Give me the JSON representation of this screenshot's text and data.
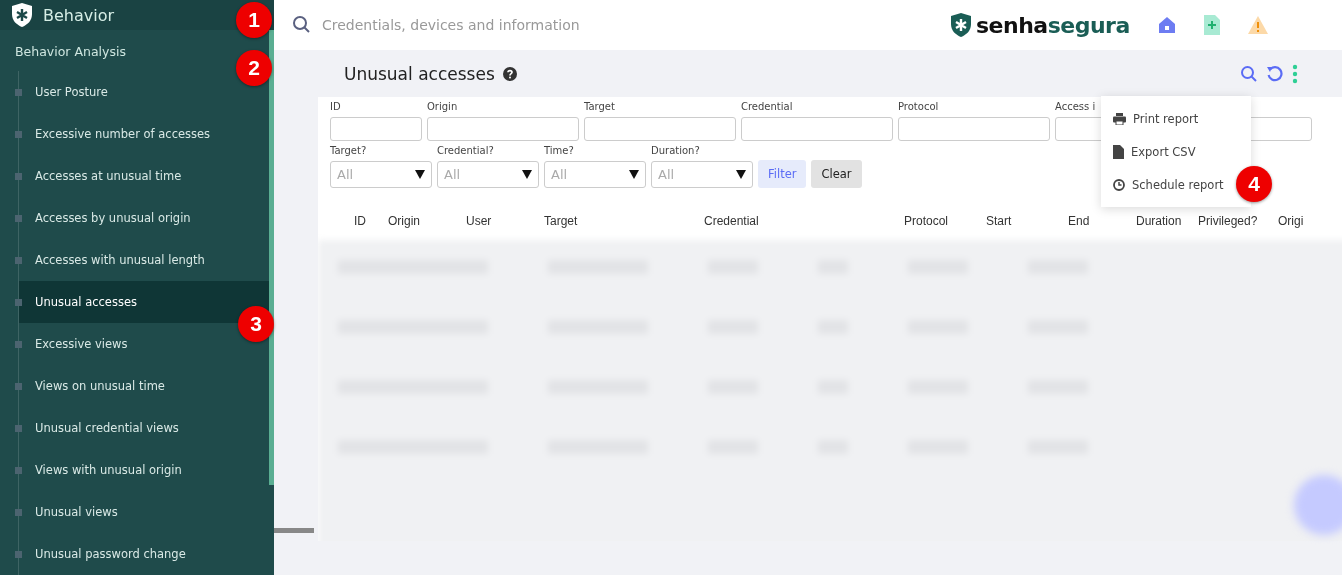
{
  "sidebar": {
    "title": "Behavior",
    "section": "Behavior Analysis",
    "items": [
      {
        "label": "User Posture",
        "selected": false
      },
      {
        "label": "Excessive number of accesses",
        "selected": false
      },
      {
        "label": "Accesses at unusual time",
        "selected": false
      },
      {
        "label": "Accesses by unusual origin",
        "selected": false
      },
      {
        "label": "Accesses with unusual length",
        "selected": false
      },
      {
        "label": "Unusual accesses",
        "selected": true
      },
      {
        "label": "Excessive views",
        "selected": false
      },
      {
        "label": "Views on unusual time",
        "selected": false
      },
      {
        "label": "Unusual credential views",
        "selected": false
      },
      {
        "label": "Views with unusual origin",
        "selected": false
      },
      {
        "label": "Unusual views",
        "selected": false
      },
      {
        "label": "Unusual password change",
        "selected": false
      }
    ]
  },
  "search": {
    "placeholder": "Credentials, devices and information"
  },
  "brand": {
    "part_1": "senha",
    "part_2": "segura"
  },
  "page": {
    "title": "Unusual accesses"
  },
  "filters": {
    "text_fields": [
      {
        "label": "ID"
      },
      {
        "label": "Origin"
      },
      {
        "label": "Target"
      },
      {
        "label": "Credential"
      },
      {
        "label": "Protocol"
      },
      {
        "label": "Access i"
      }
    ],
    "selects": [
      {
        "label": "Target?",
        "value": "All"
      },
      {
        "label": "Credential?",
        "value": "All"
      },
      {
        "label": "Time?",
        "value": "All"
      },
      {
        "label": "Duration?",
        "value": "All"
      }
    ],
    "buttons": [
      "Filter",
      "Clear"
    ]
  },
  "menu": [
    {
      "kind": "print",
      "label": "Print report"
    },
    {
      "kind": "file",
      "label": "Export CSV"
    },
    {
      "kind": "clock",
      "label": "Schedule report"
    }
  ],
  "table": {
    "columns": [
      "ID",
      "Origin",
      "User",
      "Target",
      "Credential",
      "Protocol",
      "Start",
      "End",
      "Duration",
      "Privileged?",
      "Origi"
    ]
  },
  "callouts": [
    "1",
    "2",
    "3",
    "4"
  ]
}
